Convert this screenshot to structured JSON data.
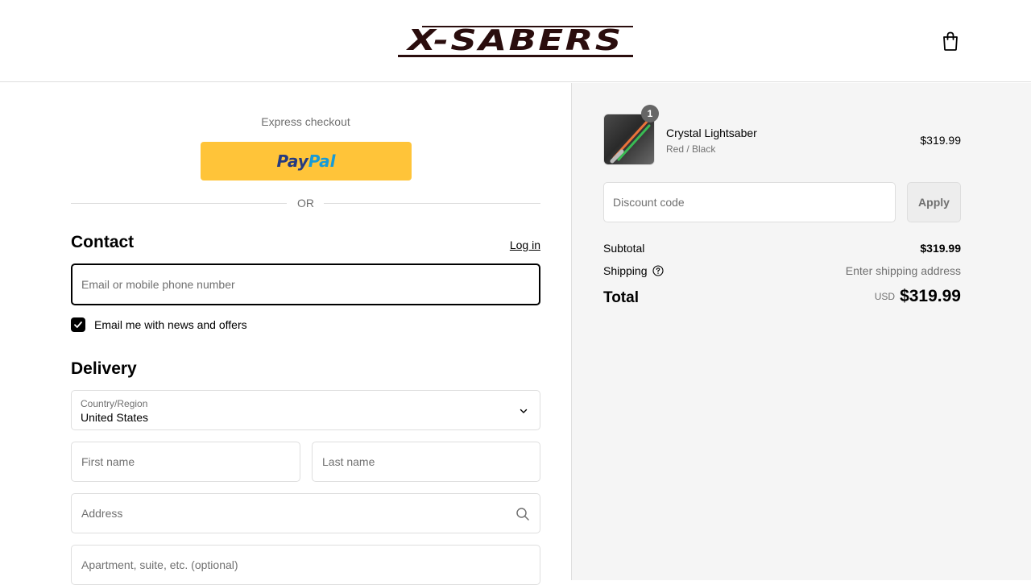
{
  "header": {
    "logo_text": "X-SABERS",
    "cart_icon": "shopping-bag-icon"
  },
  "express": {
    "label": "Express checkout",
    "paypal_dark": "Pay",
    "paypal_light": "Pal",
    "or_text": "OR"
  },
  "contact": {
    "title": "Contact",
    "login_link": "Log in",
    "email_placeholder": "Email or mobile phone number",
    "newsletter_label": "Email me with news and offers",
    "newsletter_checked": true
  },
  "delivery": {
    "title": "Delivery",
    "country_label": "Country/Region",
    "country_value": "United States",
    "first_name_placeholder": "First name",
    "last_name_placeholder": "Last name",
    "address_placeholder": "Address",
    "apartment_placeholder": "Apartment, suite, etc. (optional)"
  },
  "summary": {
    "item": {
      "name": "Crystal Lightsaber",
      "variant": "Red / Black",
      "price": "$319.99",
      "quantity": "1"
    },
    "discount_placeholder": "Discount code",
    "apply_label": "Apply",
    "subtotal_label": "Subtotal",
    "subtotal_value": "$319.99",
    "shipping_label": "Shipping",
    "shipping_value": "Enter shipping address",
    "total_label": "Total",
    "currency": "USD",
    "total_value": "$319.99"
  },
  "colors": {
    "paypal_yellow": "#ffc439",
    "paypal_dark_blue": "#253b80",
    "paypal_light_blue": "#179bd7",
    "logo": "#2a0d0d",
    "summary_bg": "#f5f5f5"
  }
}
